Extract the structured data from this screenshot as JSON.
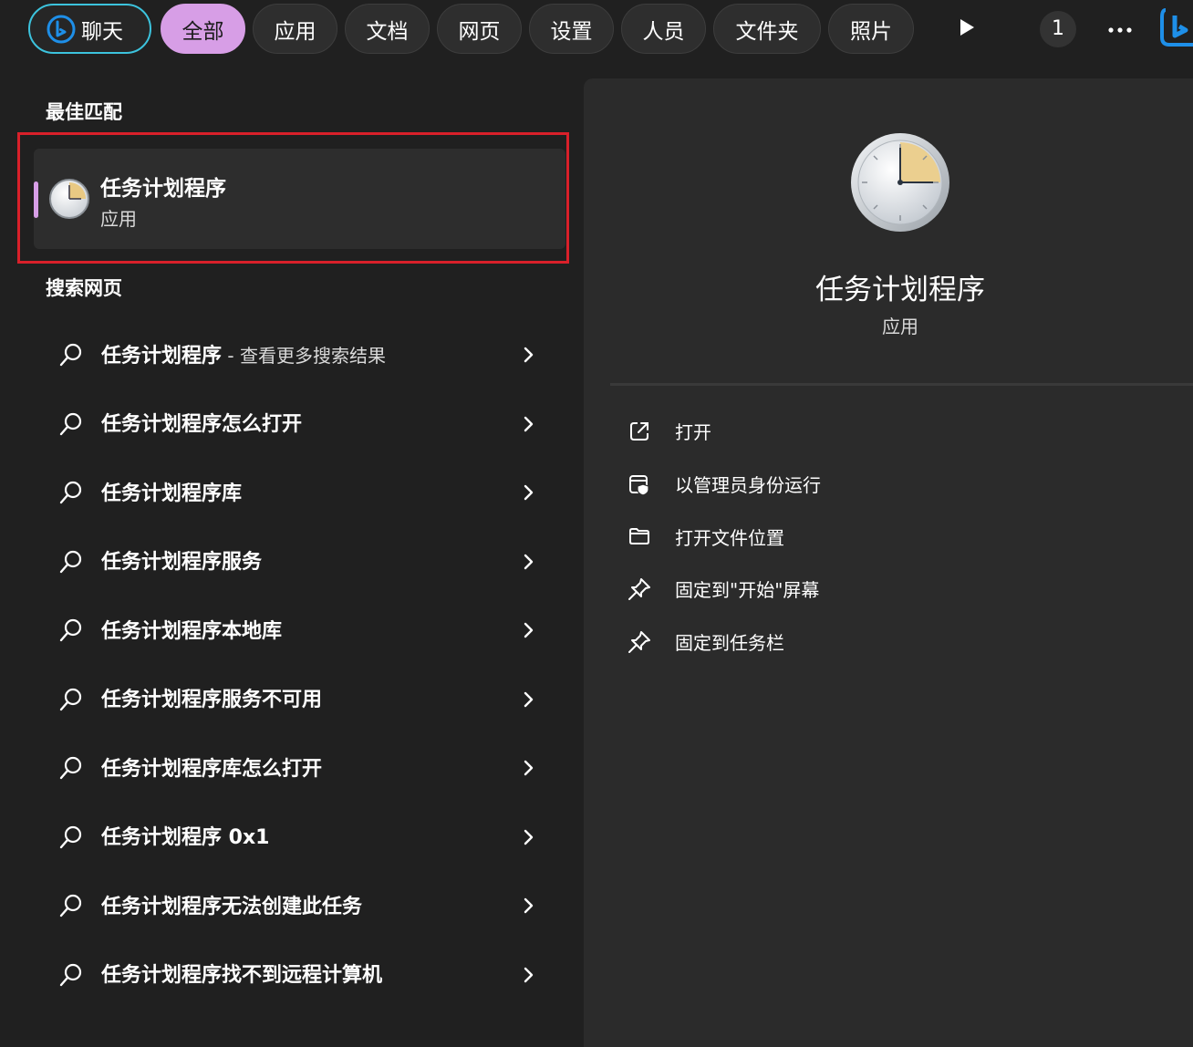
{
  "tabs": {
    "chat": "聊天",
    "items": [
      {
        "label": "全部",
        "active": true
      },
      {
        "label": "应用"
      },
      {
        "label": "文档"
      },
      {
        "label": "网页"
      },
      {
        "label": "设置"
      },
      {
        "label": "人员"
      },
      {
        "label": "文件夹"
      },
      {
        "label": "照片"
      }
    ],
    "count": "1",
    "more_icon": "ellipsis-icon",
    "play_icon": "play-icon",
    "bing_icon": "bing-icon"
  },
  "best_match": {
    "heading": "最佳匹配",
    "app_name": "任务计划程序",
    "app_type": "应用",
    "icon": "clock-icon"
  },
  "web_search": {
    "heading": "搜索网页",
    "items": [
      {
        "main": "任务计划程序",
        "suffix": " - 查看更多搜索结果"
      },
      {
        "main": "任务计划程序怎么打开",
        "suffix": ""
      },
      {
        "main": "任务计划程序库",
        "suffix": ""
      },
      {
        "main": "任务计划程序服务",
        "suffix": ""
      },
      {
        "main": "任务计划程序本地库",
        "suffix": ""
      },
      {
        "main": "任务计划程序服务不可用",
        "suffix": ""
      },
      {
        "main": "任务计划程序库怎么打开",
        "suffix": ""
      },
      {
        "main": "任务计划程序 0x1",
        "suffix": ""
      },
      {
        "main": "任务计划程序无法创建此任务",
        "suffix": ""
      },
      {
        "main": "任务计划程序找不到远程计算机",
        "suffix": ""
      }
    ]
  },
  "detail": {
    "title": "任务计划程序",
    "subtitle": "应用",
    "actions": [
      {
        "label": "打开",
        "icon": "open-external-icon"
      },
      {
        "label": "以管理员身份运行",
        "icon": "run-as-admin-icon"
      },
      {
        "label": "打开文件位置",
        "icon": "folder-icon"
      },
      {
        "label": "固定到\"开始\"屏幕",
        "icon": "pin-icon"
      },
      {
        "label": "固定到任务栏",
        "icon": "pin-icon"
      }
    ]
  },
  "colors": {
    "background": "#202020",
    "pane": "#2b2b2b",
    "accent_pink": "#d79ee6",
    "chat_border": "#3cc3dd",
    "highlight_red": "#d9202a"
  }
}
